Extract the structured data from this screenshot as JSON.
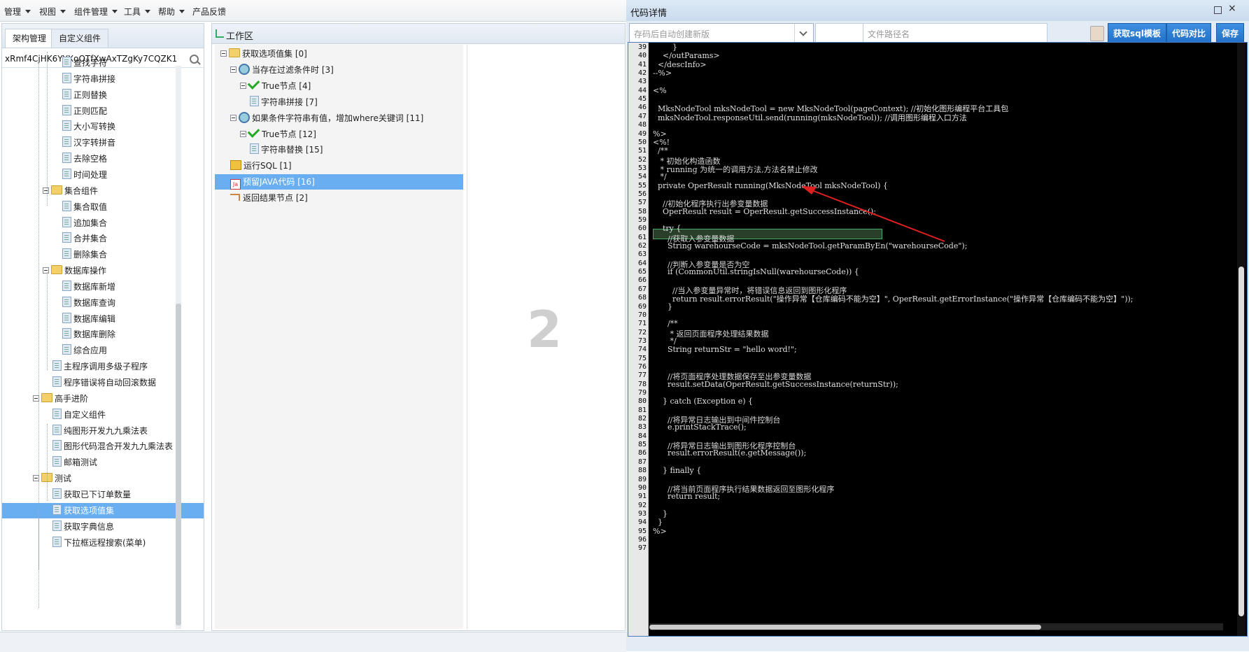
{
  "menu": {
    "items": [
      "管理",
      "视图",
      "组件管理",
      "工具",
      "帮助",
      "产品反馈"
    ]
  },
  "left_panel": {
    "tabs": [
      "架构管理",
      "自定义组件"
    ],
    "search_value": "xRmf4CjHK6YYXoOTfXwAxTZgKy7CQZK1",
    "tree": [
      {
        "label": "查找字符",
        "type": "file"
      },
      {
        "label": "字符串拼接",
        "type": "file"
      },
      {
        "label": "正则替换",
        "type": "file"
      },
      {
        "label": "正则匹配",
        "type": "file"
      },
      {
        "label": "大小写转换",
        "type": "file"
      },
      {
        "label": "汉字转拼音",
        "type": "file"
      },
      {
        "label": "去除空格",
        "type": "file"
      },
      {
        "label": "时间处理",
        "type": "file"
      },
      {
        "label": "集合组件",
        "type": "folder"
      },
      {
        "label": "集合取值",
        "type": "file"
      },
      {
        "label": "追加集合",
        "type": "file"
      },
      {
        "label": "合并集合",
        "type": "file"
      },
      {
        "label": "删除集合",
        "type": "file"
      },
      {
        "label": "数据库操作",
        "type": "folder"
      },
      {
        "label": "数据库新增",
        "type": "file"
      },
      {
        "label": "数据库查询",
        "type": "file"
      },
      {
        "label": "数据库编辑",
        "type": "file"
      },
      {
        "label": "数据库删除",
        "type": "file"
      },
      {
        "label": "综合应用",
        "type": "file"
      },
      {
        "label": "主程序调用多级子程序",
        "type": "file"
      },
      {
        "label": "程序错误将自动回滚数据",
        "type": "file"
      },
      {
        "label": "高手进阶",
        "type": "folder"
      },
      {
        "label": "自定义组件",
        "type": "file"
      },
      {
        "label": "纯图形开发九九乘法表",
        "type": "file"
      },
      {
        "label": "图形代码混合开发九九乘法表",
        "type": "file"
      },
      {
        "label": "邮箱测试",
        "type": "file"
      },
      {
        "label": "测试",
        "type": "folder"
      },
      {
        "label": "获取已下订单数量",
        "type": "file"
      },
      {
        "label": "获取选项值集",
        "type": "file",
        "selected": true
      },
      {
        "label": "获取字典信息",
        "type": "file"
      },
      {
        "label": "下拉框远程搜索(菜单)",
        "type": "file"
      }
    ]
  },
  "work": {
    "title": "工作区",
    "flow": [
      {
        "label": "获取选项值集 [0]",
        "icon": "folder-icon"
      },
      {
        "label": "当存在过滤条件时 [3]",
        "icon": "gear-icon"
      },
      {
        "label": "True节点 [4]",
        "icon": "check-icon"
      },
      {
        "label": "字符串拼接 [7]",
        "icon": "file-icon"
      },
      {
        "label": "如果条件字符串有值，增加where关键词 [11]",
        "icon": "gear-icon"
      },
      {
        "label": "True节点 [12]",
        "icon": "check-icon"
      },
      {
        "label": "字符串替换 [15]",
        "icon": "file-icon"
      },
      {
        "label": "运行SQL [1]",
        "icon": "sql-icon"
      },
      {
        "label": "预留JAVA代码 [16]",
        "icon": "java-icon",
        "selected": true
      },
      {
        "label": "返回结果节点 [2]",
        "icon": "return-icon"
      }
    ],
    "canvas_number": "2"
  },
  "dialog": {
    "title": "代码详情",
    "version_placeholder": "存码后自动创建新版",
    "path_placeholder": "文件路径名",
    "buttons": [
      "获取sql模板",
      "代码对比",
      "保存"
    ]
  },
  "code": {
    "first_line_number": 39,
    "lines": [
      "        }",
      "    </outParams>",
      "  </descInfo>",
      "--%>",
      "",
      "<%",
      "",
      "  MksNodeTool mksNodeTool = new MksNodeTool(pageContext); //初始化图形编程平台工具包",
      "  mksNodeTool.responseUtil.send(running(mksNodeTool)); //调用图形编程入口方法",
      "",
      "%>",
      "<%!",
      "  /**",
      "   * 初始化构造函数",
      "   * running 为统一的调用方法,方法名禁止修改",
      "   */",
      "  private OperResult running(MksNodeTool mksNodeTool) {",
      "",
      "    //初始化程序执行出参变量数据",
      "    OperResult result = OperResult.getSuccessInstance();",
      "",
      "    try {",
      "      //获取入参变量数据",
      "      String warehourseCode = mksNodeTool.getParamByEn(\"warehourseCode\");",
      "",
      "      //判断入参变量是否为空",
      "      if (CommonUtil.stringIsNull(warehourseCode)) {",
      "",
      "        //当入参变量异常时，将错误信息返回到图形化程序",
      "        return result.errorResult(\"操作异常【仓库编码不能为空】\", OperResult.getErrorInstance(\"操作异常【仓库编码不能为空】\"));",
      "      }",
      "",
      "      /**",
      "       * 返回页面程序处理结果数据",
      "       */",
      "      String returnStr = \"hello word!\";",
      "",
      "",
      "      //将页面程序处理数据保存至出参变量数据",
      "      result.setData(OperResult.getSuccessInstance(returnStr));",
      "",
      "    } catch (Exception e) {",
      "",
      "      //将异常日志输出到中间件控制台",
      "      e.printStackTrace();",
      "",
      "      //将异常日志输出到图形化程序控制台",
      "      result.errorResult(e.getMessage());",
      "",
      "    } finally {",
      "",
      "      //将当前页面程序执行结果数据返回至图形化程序",
      "      return result;",
      "",
      "    }",
      "  }",
      "%>",
      "",
      ""
    ]
  }
}
